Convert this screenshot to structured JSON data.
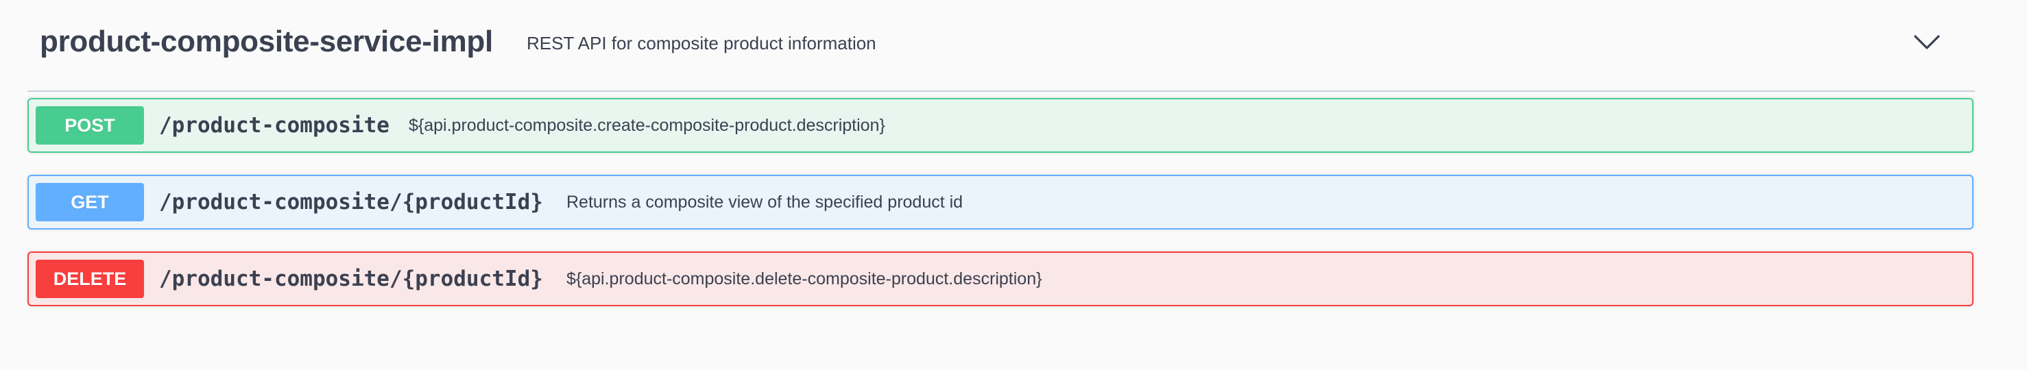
{
  "tag": {
    "name": "product-composite-service-impl",
    "description": "REST API for composite product information",
    "expand_icon": "chevron-down-icon"
  },
  "operations": [
    {
      "method": "POST",
      "path": "/product-composite",
      "summary": "${api.product-composite.create-composite-product.description}",
      "color": "#49cc90",
      "background": "#e8f6f0"
    },
    {
      "method": "GET",
      "path": "/product-composite/{productId}",
      "summary": "Returns a composite view of the specified product id",
      "color": "#61affe",
      "background": "#ebf3fb"
    },
    {
      "method": "DELETE",
      "path": "/product-composite/{productId}",
      "summary": "${api.product-composite.delete-composite-product.description}",
      "color": "#f93e3e",
      "background": "#fae7e7"
    }
  ]
}
